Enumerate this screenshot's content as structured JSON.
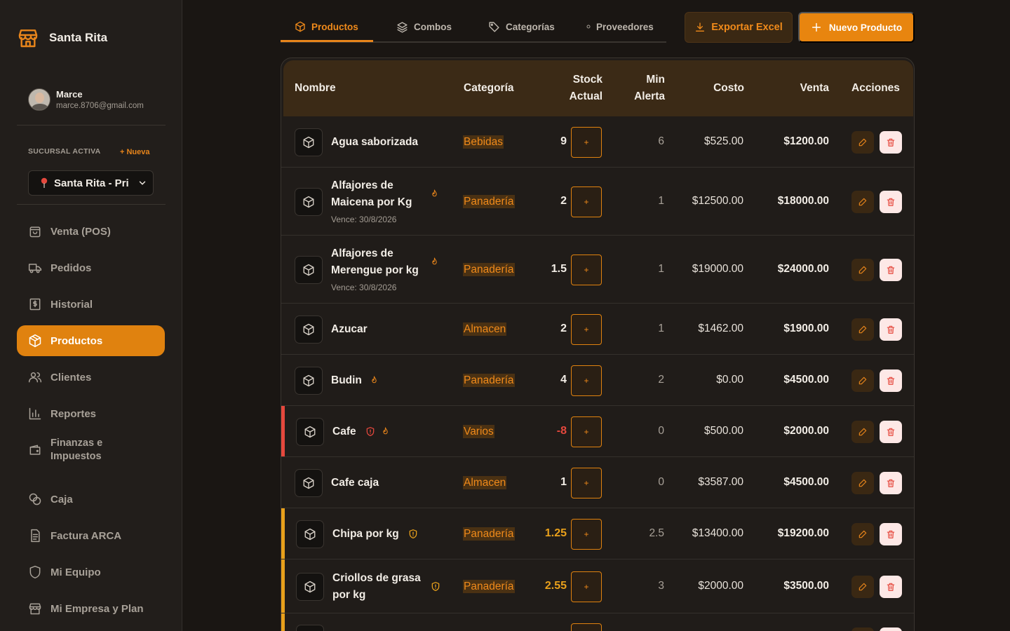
{
  "brand": {
    "name": "Santa Rita"
  },
  "user": {
    "name": "Marce",
    "email": "marce.8706@gmail.com"
  },
  "branch": {
    "label": "SUCURSAL ACTIVA",
    "new_label": "+ Nueva",
    "selected": "Santa Rita - Pri"
  },
  "nav": [
    {
      "label": "Venta (POS)",
      "icon": "shopping-bag-icon"
    },
    {
      "label": "Pedidos",
      "icon": "truck-icon"
    },
    {
      "label": "Historial",
      "icon": "receipt-icon"
    },
    {
      "label": "Productos",
      "icon": "box-icon",
      "active": true
    },
    {
      "label": "Clientes",
      "icon": "users-icon"
    },
    {
      "label": "Reportes",
      "icon": "bar-chart-icon"
    },
    {
      "label": "Finanzas e Impuestos",
      "icon": "wallet-icon"
    },
    {
      "label": "Caja",
      "icon": "coins-icon"
    },
    {
      "label": "Factura ARCA",
      "icon": "file-text-icon"
    },
    {
      "label": "Mi Equipo",
      "icon": "shield-icon"
    },
    {
      "label": "Mi Empresa y Plan",
      "icon": "store-icon"
    }
  ],
  "tabs": [
    {
      "label": "Productos",
      "icon": "box-icon",
      "active": true
    },
    {
      "label": "Combos",
      "icon": "layers-icon"
    },
    {
      "label": "Categorías",
      "icon": "tag-icon"
    },
    {
      "label": "Proveedores",
      "icon": "dot-icon"
    }
  ],
  "actions": {
    "export_label": "Exportar Excel",
    "new_label": "Nuevo Producto"
  },
  "colors": {
    "accent": "#e8850f",
    "danger": "#e5483d",
    "warning": "#e8a01b"
  },
  "table": {
    "headers": {
      "nombre": "Nombre",
      "categoria": "Categoría",
      "stock_1": "Stock",
      "stock_2": "Actual",
      "min_1": "Min",
      "min_2": "Alerta",
      "costo": "Costo",
      "venta": "Venta",
      "acciones": "Acciones"
    },
    "plus_label": "+",
    "rows": [
      {
        "name_lines": [
          "Agua saborizada"
        ],
        "expiry": "",
        "category": "Bebidas",
        "stock": "9",
        "min": "6",
        "cost": "$525.00",
        "sale": "$1200.00",
        "status": "normal",
        "fire": false,
        "shield": false
      },
      {
        "name_lines": [
          "Alfajores de",
          "Maicena por Kg"
        ],
        "expiry": "Vence: 30/8/2026",
        "category": "Panadería",
        "stock": "2",
        "min": "1",
        "cost": "$12500.00",
        "sale": "$18000.00",
        "status": "normal",
        "fire": true,
        "shield": false
      },
      {
        "name_lines": [
          "Alfajores de",
          "Merengue por kg"
        ],
        "expiry": "Vence: 30/8/2026",
        "category": "Panadería",
        "stock": "1.5",
        "min": "1",
        "cost": "$19000.00",
        "sale": "$24000.00",
        "status": "normal",
        "fire": true,
        "shield": false
      },
      {
        "name_lines": [
          "Azucar"
        ],
        "expiry": "",
        "category": "Almacen",
        "stock": "2",
        "min": "1",
        "cost": "$1462.00",
        "sale": "$1900.00",
        "status": "normal",
        "fire": false,
        "shield": false
      },
      {
        "name_lines": [
          "Budin"
        ],
        "expiry": "",
        "category": "Panadería",
        "stock": "4",
        "min": "2",
        "cost": "$0.00",
        "sale": "$4500.00",
        "status": "normal",
        "fire": true,
        "shield": false
      },
      {
        "name_lines": [
          "Cafe"
        ],
        "expiry": "",
        "category": "Varios",
        "stock": "-8",
        "min": "0",
        "cost": "$500.00",
        "sale": "$2000.00",
        "status": "danger",
        "fire": true,
        "shield": true
      },
      {
        "name_lines": [
          "Cafe caja"
        ],
        "expiry": "",
        "category": "Almacen",
        "stock": "1",
        "min": "0",
        "cost": "$3587.00",
        "sale": "$4500.00",
        "status": "normal",
        "fire": false,
        "shield": false
      },
      {
        "name_lines": [
          "Chipa por kg"
        ],
        "expiry": "",
        "category": "Panadería",
        "stock": "1.25",
        "min": "2.5",
        "cost": "$13400.00",
        "sale": "$19200.00",
        "status": "warning",
        "fire": false,
        "shield": true
      },
      {
        "name_lines": [
          "Criollos de grasa",
          "por kg"
        ],
        "expiry": "",
        "category": "Panadería",
        "stock": "2.55",
        "min": "3",
        "cost": "$2000.00",
        "sale": "$3500.00",
        "status": "warning",
        "fire": false,
        "shield": true
      }
    ]
  }
}
